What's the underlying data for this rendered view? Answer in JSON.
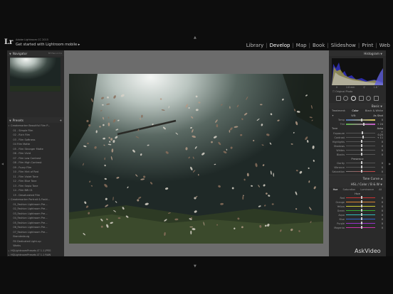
{
  "identity": {
    "logo": "Lr",
    "small": "Adobe Lightroom CC 2015",
    "main": "Get started with Lightroom mobile  ▸"
  },
  "modules": [
    "Library",
    "Develop",
    "Map",
    "Book",
    "Slideshow",
    "Print",
    "Web"
  ],
  "active_module": "Develop",
  "navigator": {
    "title": "Navigator",
    "zoom": "FIT  FILL  1:1  3:1"
  },
  "presets": {
    "title": "Presets",
    "items": [
      {
        "mark": "▾",
        "label": "Createmarker Beautiful Film P..."
      },
      {
        "mark": "",
        "label": "   01 - Simple Film"
      },
      {
        "mark": "",
        "label": "   02 - Rich Film"
      },
      {
        "mark": "",
        "label": "   03 - Film Softness"
      },
      {
        "mark": "",
        "label": "   04 Film Matte"
      },
      {
        "mark": "",
        "label": "   05 - Film Stronger Matte"
      },
      {
        "mark": "",
        "label": "   06 - Film Vivid"
      },
      {
        "mark": "",
        "label": "   07 - Film Low Contrast"
      },
      {
        "mark": "",
        "label": "   08 - Film High Contrast"
      },
      {
        "mark": "",
        "label": "   09 - Fuzzy Film"
      },
      {
        "mark": "",
        "label": "   10 - Film Hint of Red"
      },
      {
        "mark": "",
        "label": "   11 - Film Violet Tone"
      },
      {
        "mark": "",
        "label": "   12 - Film Blue Tone"
      },
      {
        "mark": "",
        "label": "   13 - Film Sepia Tone"
      },
      {
        "mark": "",
        "label": "   14 - Film BW 01"
      },
      {
        "mark": "",
        "label": "   15 - Desaturated Film"
      },
      {
        "mark": "▾",
        "label": "Createmarker Portrait & Fashi..."
      },
      {
        "mark": "",
        "label": "   01_Fashion Lightroom Pre..."
      },
      {
        "mark": "",
        "label": "   02_Fashion Lightroom Pre..."
      },
      {
        "mark": "",
        "label": "   03_Fashion Lightroom Pre..."
      },
      {
        "mark": "",
        "label": "   04_Fashion Lightroom Pre..."
      },
      {
        "mark": "",
        "label": "   05_Fashion Lightroom Pre..."
      },
      {
        "mark": "",
        "label": "   06_Fashion Lightroom Pre..."
      },
      {
        "mark": "",
        "label": "   07_Fashion Lightroom Pre..."
      },
      {
        "mark": "",
        "label": "   Brandenburg"
      },
      {
        "mark": "",
        "label": "   Fill Dedicated Light-up"
      },
      {
        "mark": "",
        "label": "   Works"
      },
      {
        "mark": "▸",
        "label": "HQLightroomPresets LT 1.1 JPEG"
      },
      {
        "mark": "▸",
        "label": "HQLightroomPresets LT 1.1 RAW"
      },
      {
        "mark": "▸",
        "label": "HQLightroomPresets LT 1.1 TIF"
      }
    ]
  },
  "histogram": {
    "title": "Histogram",
    "iso": "0",
    "focal": "2.8 mm",
    "aperture": "f/",
    "shutter": "1.8 ″",
    "original_photo": "Original Photo"
  },
  "basic": {
    "title": "Basic",
    "treatment_label": "Treatment:",
    "treatment_color": "Color",
    "treatment_bw": "Black & White",
    "wb_label": "WB:",
    "wb_value": "As Shot",
    "temp_label": "Temp",
    "temp_value": "0",
    "tint_label": "Tint",
    "tint_value": "+ 24",
    "tone_label": "Tone",
    "tone_auto": "Auto",
    "exposure_label": "Exposure",
    "exposure_value": "+ 0.25",
    "contrast_label": "Contrast",
    "contrast_value": "+ 11",
    "highlights_label": "Highlights",
    "highlights_value": "0",
    "shadows_label": "Shadows",
    "shadows_value": "0",
    "whites_label": "Whites",
    "whites_value": "0",
    "blacks_label": "Blacks",
    "blacks_value": "0",
    "presence_label": "Presence",
    "clarity_label": "Clarity",
    "clarity_value": "0",
    "vibrance_label": "Vibrance",
    "vibrance_value": "0",
    "saturation_label": "Saturation",
    "saturation_value": "0"
  },
  "tone_curve": {
    "title": "Tone Curve"
  },
  "hsl": {
    "title": "HSL / Color / B & W",
    "tabs": [
      "Hue",
      "Saturation",
      "Luminance",
      "All"
    ],
    "section": "Hue",
    "items": [
      {
        "label": "Red",
        "value": "0"
      },
      {
        "label": "Orange",
        "value": "0"
      },
      {
        "label": "Yellow",
        "value": "0"
      },
      {
        "label": "Green",
        "value": "0"
      },
      {
        "label": "Aqua",
        "value": "0"
      },
      {
        "label": "Blue",
        "value": "0"
      },
      {
        "label": "Purple",
        "value": "0"
      },
      {
        "label": "Magenta",
        "value": "0"
      }
    ]
  },
  "watermark": "AskVideo",
  "colors": {
    "panel": "#2a2a2a",
    "center": "#6c6c6c",
    "background": "#0d0d0d"
  }
}
